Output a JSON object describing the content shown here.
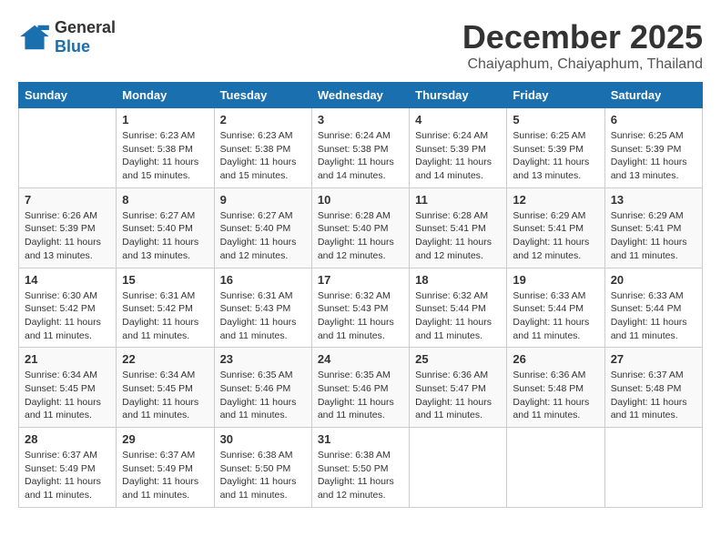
{
  "logo": {
    "general": "General",
    "blue": "Blue"
  },
  "header": {
    "month": "December 2025",
    "location": "Chaiyaphum, Chaiyaphum, Thailand"
  },
  "weekdays": [
    "Sunday",
    "Monday",
    "Tuesday",
    "Wednesday",
    "Thursday",
    "Friday",
    "Saturday"
  ],
  "weeks": [
    [
      {
        "day": "",
        "info": ""
      },
      {
        "day": "1",
        "info": "Sunrise: 6:23 AM\nSunset: 5:38 PM\nDaylight: 11 hours\nand 15 minutes."
      },
      {
        "day": "2",
        "info": "Sunrise: 6:23 AM\nSunset: 5:38 PM\nDaylight: 11 hours\nand 15 minutes."
      },
      {
        "day": "3",
        "info": "Sunrise: 6:24 AM\nSunset: 5:38 PM\nDaylight: 11 hours\nand 14 minutes."
      },
      {
        "day": "4",
        "info": "Sunrise: 6:24 AM\nSunset: 5:39 PM\nDaylight: 11 hours\nand 14 minutes."
      },
      {
        "day": "5",
        "info": "Sunrise: 6:25 AM\nSunset: 5:39 PM\nDaylight: 11 hours\nand 13 minutes."
      },
      {
        "day": "6",
        "info": "Sunrise: 6:25 AM\nSunset: 5:39 PM\nDaylight: 11 hours\nand 13 minutes."
      }
    ],
    [
      {
        "day": "7",
        "info": "Sunrise: 6:26 AM\nSunset: 5:39 PM\nDaylight: 11 hours\nand 13 minutes."
      },
      {
        "day": "8",
        "info": "Sunrise: 6:27 AM\nSunset: 5:40 PM\nDaylight: 11 hours\nand 13 minutes."
      },
      {
        "day": "9",
        "info": "Sunrise: 6:27 AM\nSunset: 5:40 PM\nDaylight: 11 hours\nand 12 minutes."
      },
      {
        "day": "10",
        "info": "Sunrise: 6:28 AM\nSunset: 5:40 PM\nDaylight: 11 hours\nand 12 minutes."
      },
      {
        "day": "11",
        "info": "Sunrise: 6:28 AM\nSunset: 5:41 PM\nDaylight: 11 hours\nand 12 minutes."
      },
      {
        "day": "12",
        "info": "Sunrise: 6:29 AM\nSunset: 5:41 PM\nDaylight: 11 hours\nand 12 minutes."
      },
      {
        "day": "13",
        "info": "Sunrise: 6:29 AM\nSunset: 5:41 PM\nDaylight: 11 hours\nand 11 minutes."
      }
    ],
    [
      {
        "day": "14",
        "info": "Sunrise: 6:30 AM\nSunset: 5:42 PM\nDaylight: 11 hours\nand 11 minutes."
      },
      {
        "day": "15",
        "info": "Sunrise: 6:31 AM\nSunset: 5:42 PM\nDaylight: 11 hours\nand 11 minutes."
      },
      {
        "day": "16",
        "info": "Sunrise: 6:31 AM\nSunset: 5:43 PM\nDaylight: 11 hours\nand 11 minutes."
      },
      {
        "day": "17",
        "info": "Sunrise: 6:32 AM\nSunset: 5:43 PM\nDaylight: 11 hours\nand 11 minutes."
      },
      {
        "day": "18",
        "info": "Sunrise: 6:32 AM\nSunset: 5:44 PM\nDaylight: 11 hours\nand 11 minutes."
      },
      {
        "day": "19",
        "info": "Sunrise: 6:33 AM\nSunset: 5:44 PM\nDaylight: 11 hours\nand 11 minutes."
      },
      {
        "day": "20",
        "info": "Sunrise: 6:33 AM\nSunset: 5:44 PM\nDaylight: 11 hours\nand 11 minutes."
      }
    ],
    [
      {
        "day": "21",
        "info": "Sunrise: 6:34 AM\nSunset: 5:45 PM\nDaylight: 11 hours\nand 11 minutes."
      },
      {
        "day": "22",
        "info": "Sunrise: 6:34 AM\nSunset: 5:45 PM\nDaylight: 11 hours\nand 11 minutes."
      },
      {
        "day": "23",
        "info": "Sunrise: 6:35 AM\nSunset: 5:46 PM\nDaylight: 11 hours\nand 11 minutes."
      },
      {
        "day": "24",
        "info": "Sunrise: 6:35 AM\nSunset: 5:46 PM\nDaylight: 11 hours\nand 11 minutes."
      },
      {
        "day": "25",
        "info": "Sunrise: 6:36 AM\nSunset: 5:47 PM\nDaylight: 11 hours\nand 11 minutes."
      },
      {
        "day": "26",
        "info": "Sunrise: 6:36 AM\nSunset: 5:48 PM\nDaylight: 11 hours\nand 11 minutes."
      },
      {
        "day": "27",
        "info": "Sunrise: 6:37 AM\nSunset: 5:48 PM\nDaylight: 11 hours\nand 11 minutes."
      }
    ],
    [
      {
        "day": "28",
        "info": "Sunrise: 6:37 AM\nSunset: 5:49 PM\nDaylight: 11 hours\nand 11 minutes."
      },
      {
        "day": "29",
        "info": "Sunrise: 6:37 AM\nSunset: 5:49 PM\nDaylight: 11 hours\nand 11 minutes."
      },
      {
        "day": "30",
        "info": "Sunrise: 6:38 AM\nSunset: 5:50 PM\nDaylight: 11 hours\nand 11 minutes."
      },
      {
        "day": "31",
        "info": "Sunrise: 6:38 AM\nSunset: 5:50 PM\nDaylight: 11 hours\nand 12 minutes."
      },
      {
        "day": "",
        "info": ""
      },
      {
        "day": "",
        "info": ""
      },
      {
        "day": "",
        "info": ""
      }
    ]
  ]
}
